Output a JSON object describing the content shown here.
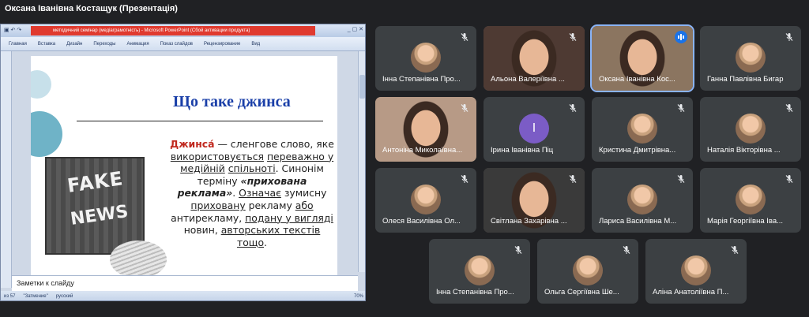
{
  "window": {
    "title": "Оксана Іванівна Костащук (Презентація)"
  },
  "presentation": {
    "titlebar": "методичний семінар (медіаграмотність) - Microsoft PowerPoint (Сбой активации продукта)",
    "ribbon_tabs": [
      "Главная",
      "Вставка",
      "Дизайн",
      "Переходы",
      "Анимация",
      "Показ слайдов",
      "Рецензирование",
      "Вид"
    ],
    "slide": {
      "title": "Що таке джинса",
      "image_line1": "FAKE",
      "image_line2": "NEWS",
      "term": "Джинса́",
      "p1": " — сленгове слово, яке ",
      "p1u": "використовується",
      "p2": " ",
      "p2u": "переважно у медійній",
      "p3": " ",
      "p3u": "спільноті",
      "p4": ". Синонім терміну ",
      "p4b": "«прихована реклама»",
      "p5": ". ",
      "p5u": "Означає",
      "p6": " зумисну ",
      "p6u": "приховану",
      "p7": " рекламу ",
      "p7u": "або",
      "p8": " антирекламу, ",
      "p8u": "подану у вигляді",
      "p9": " новин, ",
      "p9u": "авторських текстів",
      "p10": " ",
      "p10u": "тощо",
      "p11": "."
    },
    "notes_placeholder": "Заметки к слайду",
    "status": {
      "slide_counter": "из 57",
      "theme": "\"Затмение\"",
      "language": "русский",
      "zoom": "70%"
    }
  },
  "participants": [
    {
      "name": "Інна Степанівна Про...",
      "kind": "avatar"
    },
    {
      "name": "Альона Валеріївна ...",
      "kind": "video"
    },
    {
      "name": "Оксана Іванівна Кос...",
      "kind": "video",
      "speaking": true
    },
    {
      "name": "Ганна Павлівна Бигар",
      "kind": "avatar"
    },
    {
      "name": "Антоніна Миколаївна...",
      "kind": "video"
    },
    {
      "name": "Ірина Іванівна Піц",
      "kind": "letter",
      "letter": "І"
    },
    {
      "name": "Кристина Дмитрівна...",
      "kind": "avatar"
    },
    {
      "name": "Наталія Вікторівна ...",
      "kind": "avatar"
    },
    {
      "name": "Олеся Василівна Ол...",
      "kind": "avatar"
    },
    {
      "name": "Світлана Захарівна ...",
      "kind": "video"
    },
    {
      "name": "Лариса Василівна М...",
      "kind": "avatar"
    },
    {
      "name": "Марія Георгіївна Іва...",
      "kind": "avatar"
    },
    {
      "name": "Інна Степанівна Про...",
      "kind": "avatar"
    },
    {
      "name": "Ольга Сергіївна Ше...",
      "kind": "avatar"
    },
    {
      "name": "Аліна Анатоліївна П...",
      "kind": "avatar"
    }
  ],
  "colors": {
    "background": "#202124",
    "tile": "#3c4043",
    "speaking_accent": "#1a73e8",
    "letter_avatar": "#7b5cc6"
  }
}
